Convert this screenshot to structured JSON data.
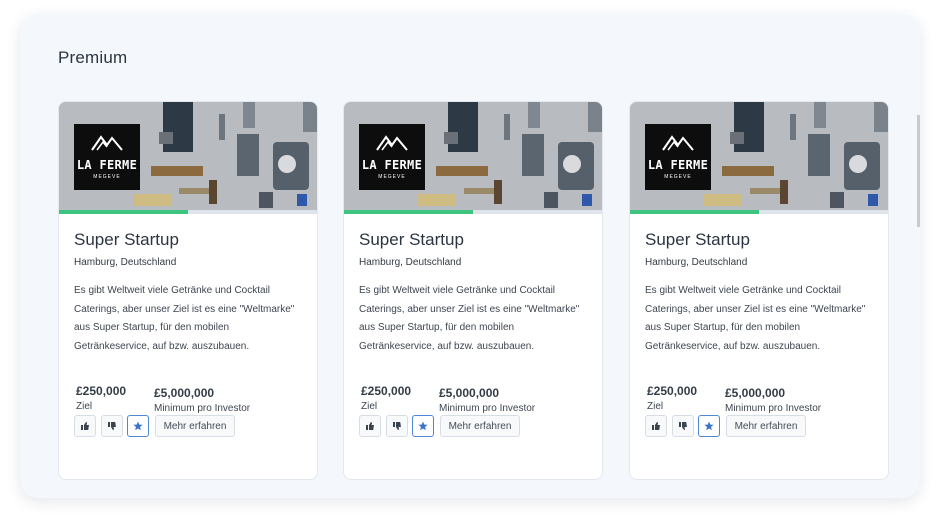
{
  "section": {
    "title": "Premium"
  },
  "cards": [
    {
      "logo": {
        "name": "LA FERME",
        "sub": "MEGEVE"
      },
      "progress": 0.5,
      "title": "Super Startup",
      "location": "Hamburg, Deutschland",
      "description": "Es gibt Weltweit viele Getränke und Cocktail Caterings, aber unser Ziel ist es eine \"Weltmarke\" aus Super Startup, für den mobilen Getränkeservice, auf bzw. auszubauen.",
      "goal": {
        "value": "£250,000",
        "label": "Ziel"
      },
      "minimum": {
        "value": "£5,000,000",
        "label": "Minimum pro Investor"
      },
      "actions": {
        "like": "thumbs-up-icon",
        "dislike": "thumbs-down-icon",
        "favorite": "star-icon",
        "more_label": "Mehr erfahren"
      }
    },
    {
      "logo": {
        "name": "LA FERME",
        "sub": "MEGEVE"
      },
      "progress": 0.5,
      "title": "Super Startup",
      "location": "Hamburg, Deutschland",
      "description": "Es gibt Weltweit viele Getränke und Cocktail Caterings, aber unser Ziel ist es eine \"Weltmarke\" aus Super Startup, für den mobilen Getränkeservice, auf bzw. auszubauen.",
      "goal": {
        "value": "£250,000",
        "label": "Ziel"
      },
      "minimum": {
        "value": "£5,000,000",
        "label": "Minimum pro Investor"
      },
      "actions": {
        "like": "thumbs-up-icon",
        "dislike": "thumbs-down-icon",
        "favorite": "star-icon",
        "more_label": "Mehr erfahren"
      }
    },
    {
      "logo": {
        "name": "LA FERME",
        "sub": "MEGEVE"
      },
      "progress": 0.5,
      "title": "Super Startup",
      "location": "Hamburg, Deutschland",
      "description": "Es gibt Weltweit viele Getränke und Cocktail Caterings, aber unser Ziel ist es eine \"Weltmarke\" aus Super Startup, für den mobilen Getränkeservice, auf bzw. auszubauen.",
      "goal": {
        "value": "£250,000",
        "label": "Ziel"
      },
      "minimum": {
        "value": "£5,000,000",
        "label": "Minimum pro Investor"
      },
      "actions": {
        "like": "thumbs-up-icon",
        "dislike": "thumbs-down-icon",
        "favorite": "star-icon",
        "more_label": "Mehr erfahren"
      }
    }
  ],
  "colors": {
    "progress": "#3dc47e",
    "favorite": "#3a74cc",
    "panel": "#f4f7fb"
  }
}
